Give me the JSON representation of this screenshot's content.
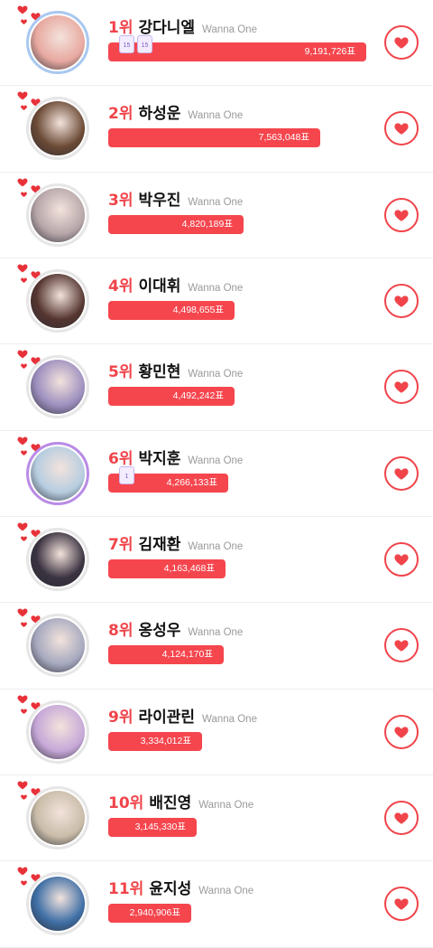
{
  "ranking": [
    {
      "rank": "1위",
      "name": "강다니엘",
      "group": "Wanna One",
      "votes": "9,191,726표",
      "share": 1.0,
      "ring": "blue",
      "badges": [
        "15",
        "15"
      ],
      "photo": "#e8a9a0"
    },
    {
      "rank": "2위",
      "name": "하성운",
      "group": "Wanna One",
      "votes": "7,563,048표",
      "share": 0.823,
      "ring": "none",
      "badges": [],
      "photo": "#6b4a35"
    },
    {
      "rank": "3위",
      "name": "박우진",
      "group": "Wanna One",
      "votes": "4,820,189표",
      "share": 0.524,
      "ring": "none",
      "badges": [],
      "photo": "#b7a6a9"
    },
    {
      "rank": "4위",
      "name": "이대휘",
      "group": "Wanna One",
      "votes": "4,498,655표",
      "share": 0.489,
      "ring": "none",
      "badges": [],
      "photo": "#553530"
    },
    {
      "rank": "5위",
      "name": "황민현",
      "group": "Wanna One",
      "votes": "4,492,242표",
      "share": 0.488,
      "ring": "none",
      "badges": [],
      "photo": "#9d8fbf"
    },
    {
      "rank": "6위",
      "name": "박지훈",
      "group": "Wanna One",
      "votes": "4,266,133표",
      "share": 0.464,
      "ring": "purple",
      "badges": [
        "1"
      ],
      "photo": "#b6cde0"
    },
    {
      "rank": "7위",
      "name": "김재환",
      "group": "Wanna One",
      "votes": "4,163,468표",
      "share": 0.453,
      "ring": "none",
      "badges": [],
      "photo": "#3a3240"
    },
    {
      "rank": "8위",
      "name": "옹성우",
      "group": "Wanna One",
      "votes": "4,124,170표",
      "share": 0.449,
      "ring": "none",
      "badges": [],
      "photo": "#a6a9bf"
    },
    {
      "rank": "9위",
      "name": "라이관린",
      "group": "Wanna One",
      "votes": "3,334,012표",
      "share": 0.363,
      "ring": "none",
      "badges": [],
      "photo": "#c7a8d8"
    },
    {
      "rank": "10위",
      "name": "배진영",
      "group": "Wanna One",
      "votes": "3,145,330표",
      "share": 0.342,
      "ring": "none",
      "badges": [],
      "photo": "#c9bca8"
    },
    {
      "rank": "11위",
      "name": "윤지성",
      "group": "Wanna One",
      "votes": "2,940,906표",
      "share": 0.32,
      "ring": "none",
      "badges": [],
      "photo": "#3f6fa6"
    }
  ],
  "colors": {
    "accent": "#f0444a",
    "bar": "#f5464e"
  },
  "icons": {
    "vote_button": "heart-icon",
    "decoration": "hearts-decoration-icon"
  }
}
